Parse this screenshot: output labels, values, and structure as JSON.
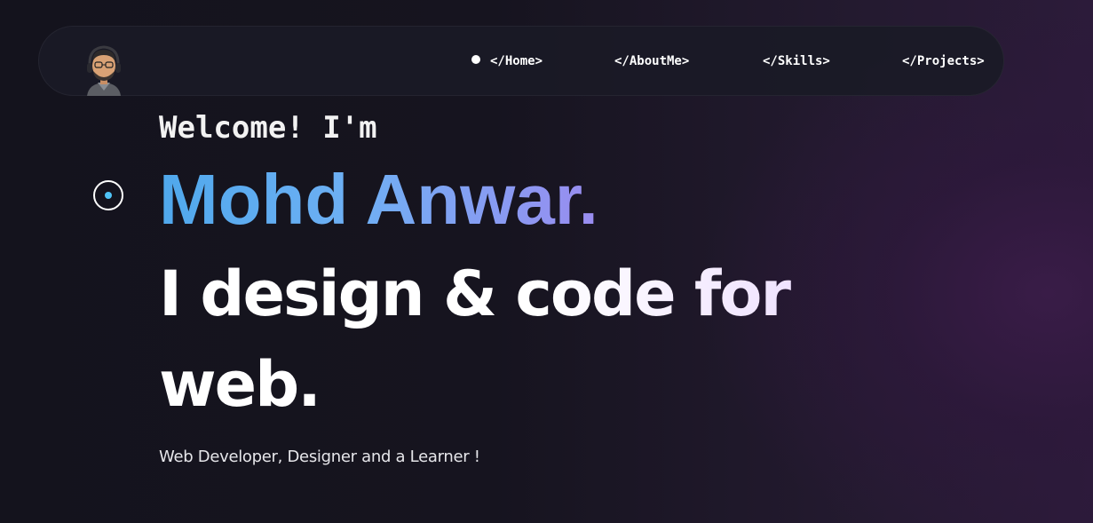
{
  "navbar": {
    "avatar_icon": "memoji-avatar-with-headphones-icon",
    "items": [
      {
        "label": "</Home>",
        "active": true
      },
      {
        "label": "</AboutMe>",
        "active": false
      },
      {
        "label": "</Skills>",
        "active": false
      },
      {
        "label": "</Projects>",
        "active": false
      }
    ]
  },
  "hero": {
    "welcome": "Welcome! I'm",
    "name": "Mohd Anwar.",
    "tagline": "I design & code for web.",
    "subtitle": "Web Developer, Designer and a Learner !"
  },
  "cursor_icon": "custom-cursor-ring-icon",
  "colors": {
    "background": "#14131d",
    "navbar_bg": "#1a1a26",
    "name_gradient_start": "#4fa8ec",
    "name_gradient_end": "#9a8cf0",
    "cursor_dot": "#4fc3f7",
    "accent_glow": "#2c1b3a"
  }
}
